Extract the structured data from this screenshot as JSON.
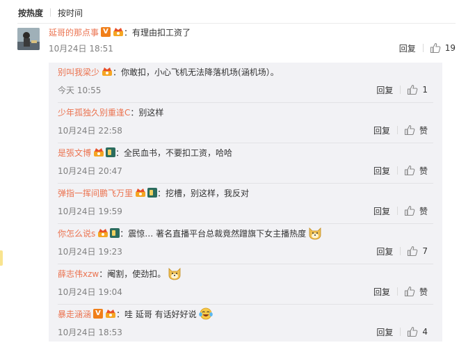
{
  "sort": {
    "hot": "按热度",
    "time": "按时间"
  },
  "actions": {
    "reply": "回复",
    "like_label": "赞"
  },
  "main": {
    "user": "延哥的那点事",
    "text": "：有理由扣工资了",
    "time": "10月24日 18:51",
    "likes": "19"
  },
  "replies": [
    {
      "user": "别叫我梁少",
      "text": "：你敢扣，小心飞机无法降落机场(涵机场）。",
      "time": "今天 10:55",
      "likes": "1"
    },
    {
      "user": "少年孤独久别重逢C",
      "text": "：别这样",
      "time": "10月24日 22:58",
      "likes": "赞"
    },
    {
      "user": "是張文博",
      "text": "：全民血书，不要扣工资，哈哈",
      "time": "10月24日 20:47",
      "likes": "赞"
    },
    {
      "user": "弹指一挥间鹏飞万里",
      "text": "：挖槽，别这样，我反对",
      "time": "10月24日 19:59",
      "likes": "赞"
    },
    {
      "user": "你怎么说s",
      "text": "：震惊… 著名直播平台总裁竟然蹭旗下女主播热度",
      "time": "10月24日 19:23",
      "likes": "7"
    },
    {
      "user": "薛志伟xzw",
      "text": "：阉割，使劲扣。",
      "time": "10月24日 19:04",
      "likes": "赞"
    },
    {
      "user": "暴走涵涵",
      "text": "：哇  延哥 有话好好说",
      "time": "10月24日 18:53",
      "likes": "4"
    }
  ],
  "colors": {
    "username": "#eb7350",
    "time": "#808080",
    "panel": "#f2f2f5"
  }
}
